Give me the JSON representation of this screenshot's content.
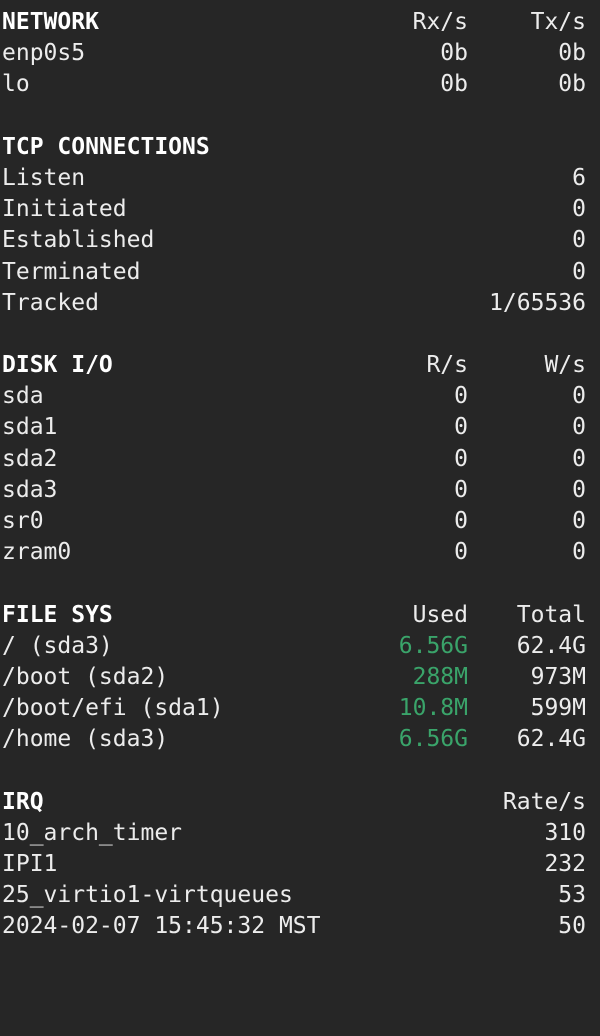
{
  "colors": {
    "background": "#262626",
    "text": "#ececec",
    "used_highlight": "#3aa46a"
  },
  "network": {
    "title": "NETWORK",
    "col1": "Rx/s",
    "col2": "Tx/s",
    "rows": [
      {
        "name": "enp0s5",
        "rx": "0b",
        "tx": "0b"
      },
      {
        "name": "lo",
        "rx": "0b",
        "tx": "0b"
      }
    ]
  },
  "tcp": {
    "title": "TCP CONNECTIONS",
    "rows": [
      {
        "name": "Listen",
        "value": "6"
      },
      {
        "name": "Initiated",
        "value": "0"
      },
      {
        "name": "Established",
        "value": "0"
      },
      {
        "name": "Terminated",
        "value": "0"
      },
      {
        "name": "Tracked",
        "value": "1/65536"
      }
    ]
  },
  "disk": {
    "title": "DISK I/O",
    "col1": "R/s",
    "col2": "W/s",
    "rows": [
      {
        "name": "sda",
        "r": "0",
        "w": "0"
      },
      {
        "name": "sda1",
        "r": "0",
        "w": "0"
      },
      {
        "name": "sda2",
        "r": "0",
        "w": "0"
      },
      {
        "name": "sda3",
        "r": "0",
        "w": "0"
      },
      {
        "name": "sr0",
        "r": "0",
        "w": "0"
      },
      {
        "name": "zram0",
        "r": "0",
        "w": "0"
      }
    ]
  },
  "filesys": {
    "title": "FILE SYS",
    "col1": "Used",
    "col2": "Total",
    "rows": [
      {
        "name": "/ (sda3)",
        "used": "6.56G",
        "total": "62.4G"
      },
      {
        "name": "/boot (sda2)",
        "used": "288M",
        "total": "973M"
      },
      {
        "name": "/boot/efi (sda1)",
        "used": "10.8M",
        "total": "599M"
      },
      {
        "name": "/home (sda3)",
        "used": "6.56G",
        "total": "62.4G"
      }
    ]
  },
  "irq": {
    "title": "IRQ",
    "col2": "Rate/s",
    "rows": [
      {
        "name": "10_arch_timer",
        "rate": "310"
      },
      {
        "name": "IPI1",
        "rate": "232"
      },
      {
        "name": "25_virtio1-virtqueues",
        "rate": "53"
      }
    ]
  },
  "footer": {
    "timestamp": "2024-02-07 15:45:32 MST",
    "rate": "50"
  }
}
